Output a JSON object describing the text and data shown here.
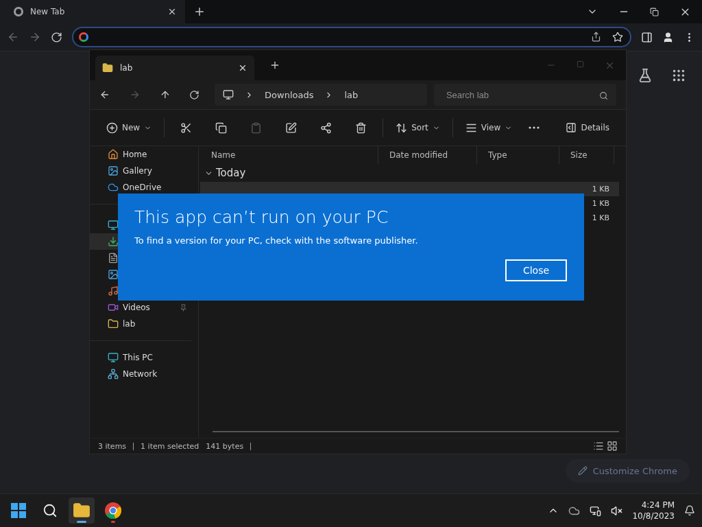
{
  "browser": {
    "tab": {
      "title": "New Tab",
      "selected": true
    },
    "customize_button": "Customize Chrome"
  },
  "explorer": {
    "tab": {
      "title": "lab"
    },
    "breadcrumb": [
      "Downloads",
      "lab"
    ],
    "search": {
      "placeholder": "Search lab"
    },
    "commands": [
      {
        "kind": "menu",
        "label": "New",
        "disabled": false
      },
      {
        "kind": "icon",
        "disabled": false
      },
      {
        "kind": "icon",
        "disabled": false
      },
      {
        "kind": "icon",
        "disabled": true
      },
      {
        "kind": "icon",
        "disabled": false
      },
      {
        "kind": "icon",
        "disabled": false
      },
      {
        "kind": "icon",
        "disabled": false
      },
      {
        "kind": "menu",
        "label": "Sort",
        "disabled": false
      },
      {
        "kind": "menu",
        "label": "View",
        "disabled": false
      },
      {
        "kind": "more",
        "disabled": false
      }
    ],
    "details_button": "Details",
    "sidebar": [
      {
        "group": [
          {
            "label": "Home",
            "selected": false
          },
          {
            "label": "Gallery",
            "selected": false
          },
          {
            "label": "OneDrive",
            "selected": false
          }
        ]
      },
      {
        "group": [
          {
            "selected": false
          },
          {
            "selected": true
          },
          {
            "selected": false
          },
          {
            "selected": false
          },
          {
            "selected": false
          },
          {
            "label": "Videos",
            "selected": false,
            "pinned": true
          },
          {
            "label": "lab",
            "selected": false,
            "pinned": false
          }
        ]
      },
      {
        "group": [
          {
            "label": "This PC",
            "selected": false
          },
          {
            "label": "Network",
            "selected": false
          }
        ]
      }
    ],
    "columns": [
      "Name",
      "Date modified",
      "Type",
      "Size"
    ],
    "group_title": "Today",
    "rows": [
      {
        "size": "1 KB",
        "selected": true
      },
      {
        "size": "1 KB",
        "selected": false
      },
      {
        "size": "1 KB",
        "selected": false
      }
    ],
    "status": {
      "count": "3 items",
      "selection": "1 item selected",
      "bytes": "141 bytes"
    }
  },
  "dialog": {
    "title": "This app can’t run on your PC",
    "message": "To find a version for your PC, check with the software publisher.",
    "button": "Close"
  },
  "taskbar": {
    "apps": [
      {
        "active": true
      },
      {
        "active": false
      }
    ],
    "time": "4:24 PM",
    "date": "10/8/2023"
  }
}
